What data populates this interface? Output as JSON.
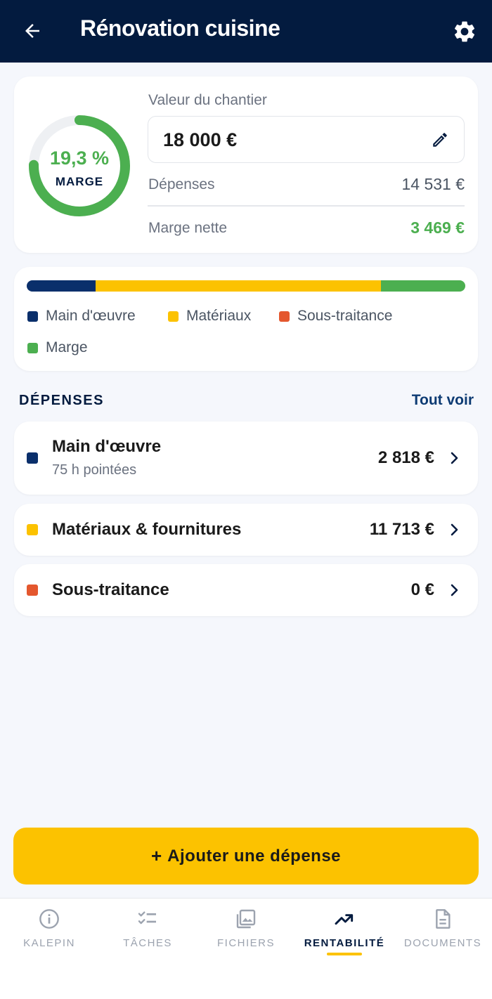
{
  "header": {
    "title": "Rénovation cuisine"
  },
  "summary": {
    "margin_percent": "19,3 %",
    "margin_fraction": 0.193,
    "margin_caption": "MARGE",
    "project_value_label": "Valeur du chantier",
    "project_value": "18 000 €",
    "expenses_label": "Dépenses",
    "expenses_value": "14 531 €",
    "net_margin_label": "Marge nette",
    "net_margin_value": "3 469 €"
  },
  "breakdown": {
    "segments": [
      {
        "name": "Main d'œuvre",
        "fraction": 0.157,
        "color": "#0a2f6b"
      },
      {
        "name": "Matériaux",
        "fraction": 0.65,
        "color": "#fcc200"
      },
      {
        "name": "Sous-traitance",
        "fraction": 0.0,
        "color": "#e4572e"
      },
      {
        "name": "Marge",
        "fraction": 0.193,
        "color": "#4caf50"
      }
    ],
    "legend": {
      "labor": "Main d'œuvre",
      "materials": "Matériaux",
      "subcontracting": "Sous-traitance",
      "margin": "Marge"
    }
  },
  "expenses_section": {
    "title": "DÉPENSES",
    "see_all": "Tout voir",
    "items": [
      {
        "label": "Main d'œuvre",
        "sublabel": "75 h pointées",
        "amount": "2 818 €",
        "color": "#0a2f6b"
      },
      {
        "label": "Matériaux & fournitures",
        "amount": "11 713 €",
        "color": "#fcc200"
      },
      {
        "label": "Sous-traitance",
        "amount": "0 €",
        "color": "#e4572e"
      }
    ]
  },
  "add_button": {
    "plus": "+",
    "label": "Ajouter une dépense"
  },
  "bottom_nav": {
    "items": [
      {
        "label": "KALEPIN",
        "icon": "info-icon"
      },
      {
        "label": "TÂCHES",
        "icon": "checklist-icon"
      },
      {
        "label": "FICHIERS",
        "icon": "image-icon"
      },
      {
        "label": "RENTABILITÉ",
        "icon": "trending-up-icon",
        "active": true
      },
      {
        "label": "DOCUMENTS",
        "icon": "document-icon"
      }
    ]
  },
  "colors": {
    "navy": "#031b3f",
    "accent_yellow": "#fcc200",
    "positive_green": "#4caf50",
    "subcontract_orange": "#e4572e"
  }
}
